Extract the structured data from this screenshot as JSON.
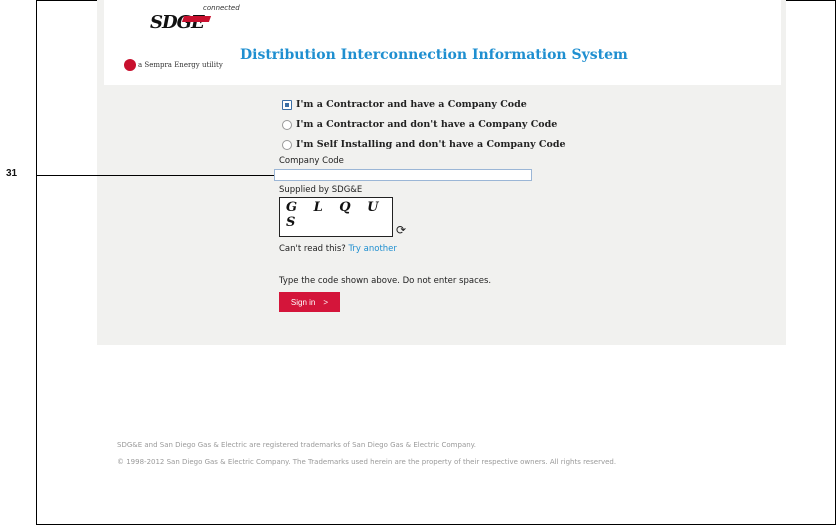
{
  "header": {
    "logo_text": "SDGE",
    "logo_sub": "connected",
    "sempra_text": "a Sempra Energy utility",
    "app_title": "Distribution Interconnection Information System"
  },
  "login": {
    "options": [
      {
        "label": "I'm a Contractor and have a Company Code",
        "selected": true
      },
      {
        "label": "I'm a Contractor and don't have a Company Code",
        "selected": false
      },
      {
        "label": "I'm Self Installing and don't have a Company Code",
        "selected": false
      }
    ],
    "company_code_label": "Company Code",
    "company_code_value": "",
    "supplied_by": "Supplied by SDG&E",
    "captcha_text": "G L Q U S",
    "cant_read": "Can't read this?",
    "try_another": "Try another",
    "instructions": "Type the code shown above. Do not enter spaces.",
    "sign_in_label": "Sign in",
    "sign_in_arrow": ">"
  },
  "footer": {
    "line1": "SDG&E and San Diego Gas & Electric are registered trademarks of San Diego Gas & Electric Company.",
    "line2": "© 1998-2012 San Diego Gas & Electric Company. The Trademarks used herein are the property of their respective owners. All rights reserved."
  },
  "callout": {
    "number": "31"
  },
  "colors": {
    "accent": "#1f8fd0",
    "brand_red": "#d4153a",
    "panel_bg": "#f1f1ef"
  }
}
